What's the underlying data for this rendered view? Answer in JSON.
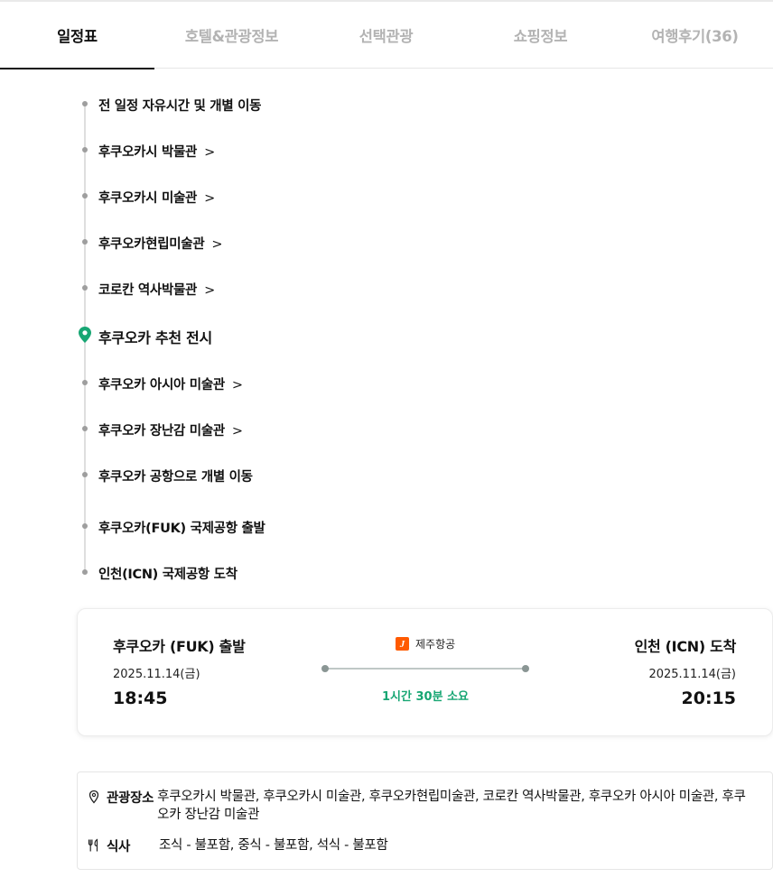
{
  "tabs": [
    {
      "label": "일정표",
      "active": true
    },
    {
      "label": "호텔&관광정보",
      "active": false
    },
    {
      "label": "선택관광",
      "active": false
    },
    {
      "label": "쇼핑정보",
      "active": false
    },
    {
      "label": "여행후기(36)",
      "active": false
    }
  ],
  "timeline": {
    "items": [
      {
        "label": "전 일정 자유시간 및 개별 이동",
        "chevron": false
      },
      {
        "label": "후쿠오카시 박물관",
        "chevron": true
      },
      {
        "label": "후쿠오카시 미술관",
        "chevron": true
      },
      {
        "label": "후쿠오카현립미술관",
        "chevron": true
      },
      {
        "label": "코로칸 역사박물관",
        "chevron": true
      },
      {
        "label": "후쿠오카 추천 전시",
        "chevron": false,
        "pin": true
      },
      {
        "label": "후쿠오카 아시아 미술관",
        "chevron": true
      },
      {
        "label": "후쿠오카 장난감 미술관",
        "chevron": true
      },
      {
        "label": "후쿠오카 공항으로 개별 이동",
        "chevron": false
      },
      {
        "label": "후쿠오카(FUK) 국제공항 출발",
        "chevron": false
      },
      {
        "label": "인천(ICN) 국제공항 도착",
        "chevron": false
      }
    ],
    "chevron_glyph": ">"
  },
  "flight": {
    "departure": {
      "title": "후쿠오카 (FUK) 출발",
      "date": "2025.11.14(금)",
      "time": "18:45"
    },
    "arrival": {
      "title": "인천 (ICN) 도착",
      "date": "2025.11.14(금)",
      "time": "20:15"
    },
    "airline": {
      "logo_letter": "J",
      "name": "제주항공",
      "color": "#ff5a00"
    },
    "duration": "1시간 30분 소요",
    "duration_color": "#17a673"
  },
  "info": {
    "sightseeing": {
      "icon": "location-pin-icon",
      "key": "관광장소",
      "value": "후쿠오카시 박물관, 후쿠오카시 미술관, 후쿠오카현립미술관, 코로칸 역사박물관, 후쿠오카 아시아 미술관, 후쿠오카 장난감 미술관"
    },
    "meal": {
      "icon": "fork-knife-icon",
      "key": "식사",
      "value": "조식 - 불포함, 중식 - 불포함, 석식 - 불포함"
    }
  },
  "colors": {
    "pin": "#17a673",
    "tab_active": "#111111",
    "tab_inactive": "#b3b3b3"
  }
}
